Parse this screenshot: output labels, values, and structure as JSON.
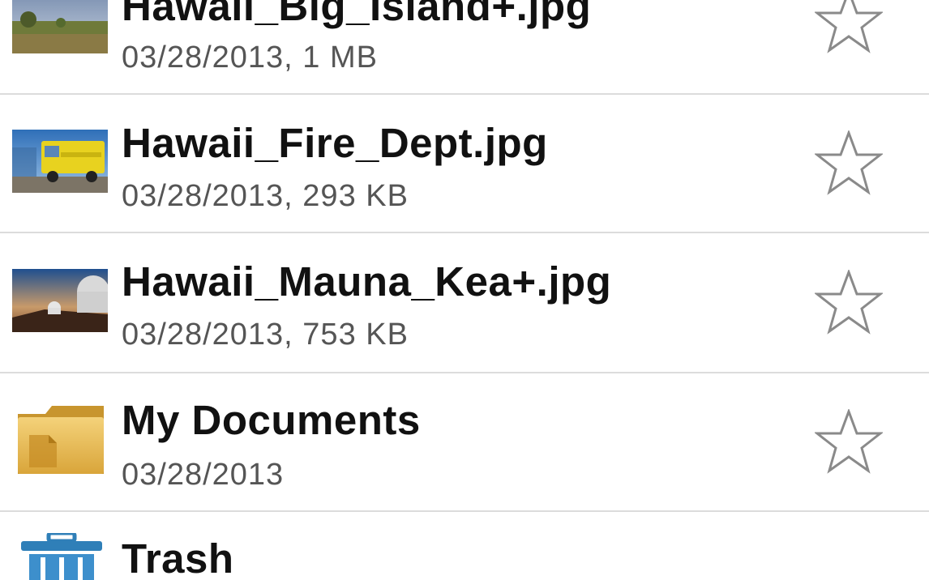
{
  "files": [
    {
      "name": "Hawaii_Big_Island+.jpg",
      "meta": "03/28/2013, 1 MB",
      "icon": "landscape-thumbnail-icon",
      "starred": false
    },
    {
      "name": "Hawaii_Fire_Dept.jpg",
      "meta": "03/28/2013, 293 KB",
      "icon": "fire-truck-thumbnail-icon",
      "starred": false
    },
    {
      "name": "Hawaii_Mauna_Kea+.jpg",
      "meta": "03/28/2013, 753 KB",
      "icon": "observatory-thumbnail-icon",
      "starred": false
    },
    {
      "name": "My Documents",
      "meta": "03/28/2013",
      "icon": "folder-icon",
      "starred": false
    },
    {
      "name": "Trash",
      "meta": "",
      "icon": "trash-icon"
    }
  ],
  "colors": {
    "text_primary": "#111111",
    "text_secondary": "#555555",
    "divider": "#dcdcdc",
    "star_outline": "#8a8a8a",
    "folder": "#e8b94a",
    "trash": "#2f7fb8"
  }
}
